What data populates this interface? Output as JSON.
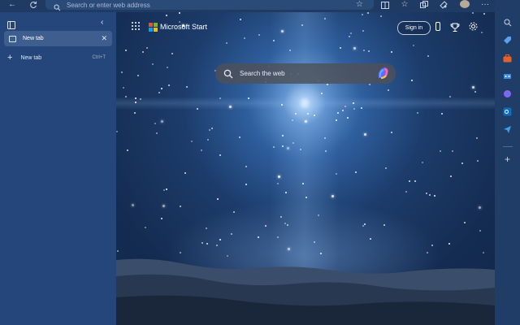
{
  "browser": {
    "address_placeholder": "Search or enter web address",
    "icons": [
      "back-icon",
      "refresh-icon",
      "search-icon",
      "favorite-star-icon",
      "split-screen-icon",
      "favorites-icon",
      "collections-icon",
      "extensions-icon",
      "profile-avatar",
      "more-icon",
      "copilot-icon"
    ]
  },
  "sidebar": {
    "tabs": [
      {
        "label": "New tab",
        "icon": "page-icon",
        "close": "✕"
      }
    ],
    "new_tab_label": "New tab",
    "new_tab_shortcut": "Ctrl+T",
    "icons": [
      "tab-actions-icon",
      "collapse-chevron-icon",
      "plus-icon"
    ]
  },
  "newtab_page": {
    "brand": "Microsoft Start",
    "sign_in": "Sign in",
    "search_placeholder": "Search the web",
    "ms_logo_colors": [
      "#f25022",
      "#7fba00",
      "#00a4ef",
      "#ffb900"
    ],
    "icons": [
      "apps-grid-icon",
      "phone-icon",
      "rewards-trophy-icon",
      "settings-gear-icon",
      "search-icon",
      "copilot-icon"
    ]
  },
  "right_sidebar": {
    "icons": [
      "search-icon",
      "shopping-tag-icon",
      "tools-briefcase-icon",
      "games-icon",
      "copilot-chat-icon",
      "outlook-icon",
      "send-icon",
      "add-icon"
    ]
  }
}
